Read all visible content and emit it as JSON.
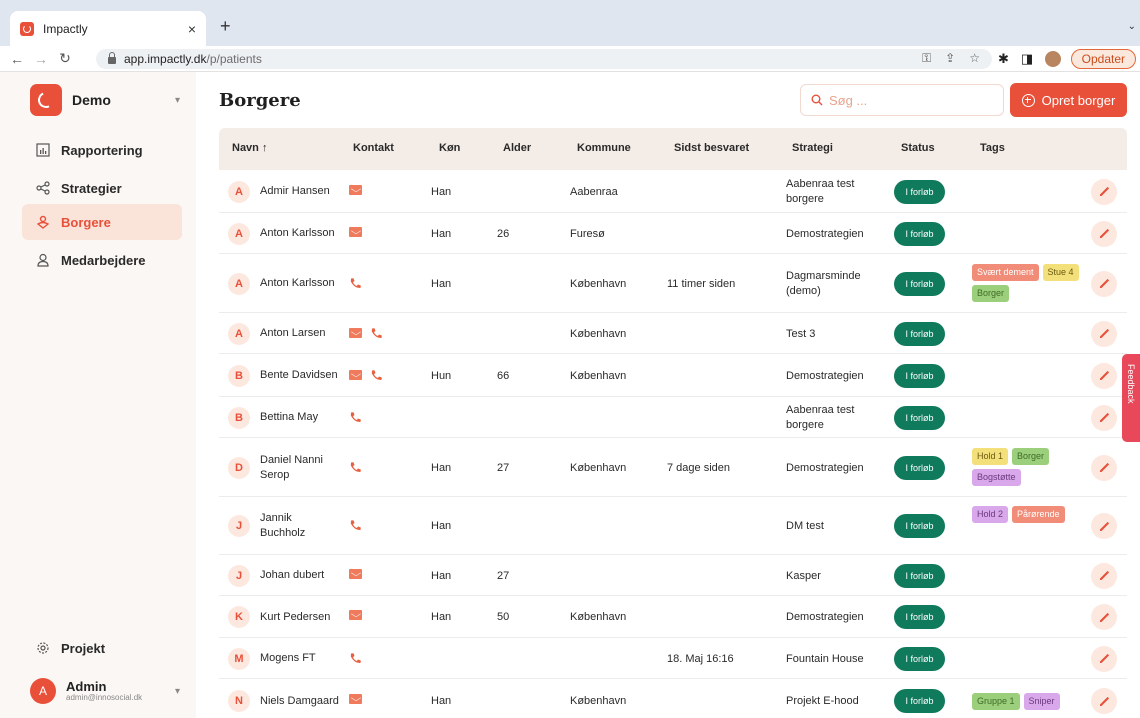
{
  "browser": {
    "tab_title": "Impactly",
    "close_glyph": "×",
    "new_tab_glyph": "+",
    "url_host": "app.impactly.dk",
    "url_path": "/p/patients",
    "update_label": "Opdater"
  },
  "workspace": {
    "name": "Demo"
  },
  "nav": {
    "items": [
      {
        "label": "Rapportering",
        "icon": "chart-icon"
      },
      {
        "label": "Strategier",
        "icon": "share-icon"
      },
      {
        "label": "Borgere",
        "icon": "citizen-icon",
        "active": true
      },
      {
        "label": "Medarbejdere",
        "icon": "user-icon"
      }
    ],
    "project_label": "Projekt"
  },
  "user": {
    "initial": "A",
    "name": "Admin",
    "email": "admin@innosocial.dk"
  },
  "page": {
    "title": "Borgere",
    "search_placeholder": "Søg ...",
    "create_label": "Opret borger"
  },
  "table": {
    "headers": [
      "Navn ↑",
      "Kontakt",
      "Køn",
      "Alder",
      "Kommune",
      "Sidst besvaret",
      "Strategi",
      "Status",
      "Tags"
    ],
    "rows": [
      {
        "initial": "A",
        "name": "Admir Hansen",
        "contact": [
          "mail"
        ],
        "gender": "Han",
        "age": "",
        "municipality": "Aabenraa",
        "last": "",
        "strategy": "Aabenraa test borgere",
        "status": "I forløb",
        "tags": []
      },
      {
        "initial": "A",
        "name": "Anton Karlsson",
        "contact": [
          "mail"
        ],
        "gender": "Han",
        "age": "26",
        "municipality": "Furesø",
        "last": "",
        "strategy": "Demostrategien",
        "status": "I forløb",
        "tags": []
      },
      {
        "initial": "A",
        "name": "Anton Karlsson",
        "contact": [
          "phone"
        ],
        "gender": "Han",
        "age": "",
        "municipality": "København",
        "last": "11 timer siden",
        "strategy": "Dagmarsminde (demo)",
        "status": "I forløb",
        "tags": [
          {
            "label": "Svært dement",
            "color": "salmon"
          },
          {
            "label": "Stue 4",
            "color": "yellow"
          },
          {
            "label": "Borger",
            "color": "green"
          }
        ]
      },
      {
        "initial": "A",
        "name": "Anton Larsen",
        "contact": [
          "mail",
          "phone"
        ],
        "gender": "",
        "age": "",
        "municipality": "København",
        "last": "",
        "strategy": "Test 3",
        "status": "I forløb",
        "tags": []
      },
      {
        "initial": "B",
        "name": "Bente Davidsen",
        "contact": [
          "mail",
          "phone"
        ],
        "gender": "Hun",
        "age": "66",
        "municipality": "København",
        "last": "",
        "strategy": "Demostrategien",
        "status": "I forløb",
        "tags": []
      },
      {
        "initial": "B",
        "name": "Bettina May",
        "contact": [
          "phone"
        ],
        "gender": "",
        "age": "",
        "municipality": "",
        "last": "",
        "strategy": "Aabenraa test borgere",
        "status": "I forløb",
        "tags": []
      },
      {
        "initial": "D",
        "name": "Daniel Nanni Serop",
        "contact": [
          "phone"
        ],
        "gender": "Han",
        "age": "27",
        "municipality": "København",
        "last": "7 dage siden",
        "strategy": "Demostrategien",
        "status": "I forløb",
        "tags": [
          {
            "label": "Hold 1",
            "color": "yellow"
          },
          {
            "label": "Borger",
            "color": "green"
          },
          {
            "label": "Bogstøtte",
            "color": "purple"
          }
        ]
      },
      {
        "initial": "J",
        "name": "Jannik Buchholz",
        "contact": [
          "phone"
        ],
        "gender": "Han",
        "age": "",
        "municipality": "",
        "last": "",
        "strategy": "DM test",
        "status": "I forløb",
        "tags": [
          {
            "label": "Hold 2",
            "color": "purple"
          },
          {
            "label": "Pårørende",
            "color": "salmon"
          }
        ]
      },
      {
        "initial": "J",
        "name": "Johan dubert",
        "contact": [
          "mail"
        ],
        "gender": "Han",
        "age": "27",
        "municipality": "",
        "last": "",
        "strategy": "Kasper",
        "status": "I forløb",
        "tags": []
      },
      {
        "initial": "K",
        "name": "Kurt Pedersen",
        "contact": [
          "mail"
        ],
        "gender": "Han",
        "age": "50",
        "municipality": "København",
        "last": "",
        "strategy": "Demostrategien",
        "status": "I forløb",
        "tags": []
      },
      {
        "initial": "M",
        "name": "Mogens FT",
        "contact": [
          "phone"
        ],
        "gender": "",
        "age": "",
        "municipality": "",
        "last": "18. Maj 16:16",
        "strategy": "Fountain House",
        "status": "I forløb",
        "tags": []
      },
      {
        "initial": "N",
        "name": "Niels Damgaard",
        "contact": [
          "mail"
        ],
        "gender": "Han",
        "age": "",
        "municipality": "København",
        "last": "",
        "strategy": "Projekt E-hood",
        "status": "I forløb",
        "tags": [
          {
            "label": "Gruppe 1",
            "color": "green"
          },
          {
            "label": "Sniper",
            "color": "purple"
          }
        ]
      }
    ]
  },
  "feedback_label": "Feedback",
  "colors": {
    "accent": "#e8503a",
    "status": "#0f7a5c",
    "tag_salmon": "#f08c78",
    "tag_yellow": "#f4e07a",
    "tag_green": "#9ccf7c",
    "tag_purple": "#d9a8ea"
  }
}
